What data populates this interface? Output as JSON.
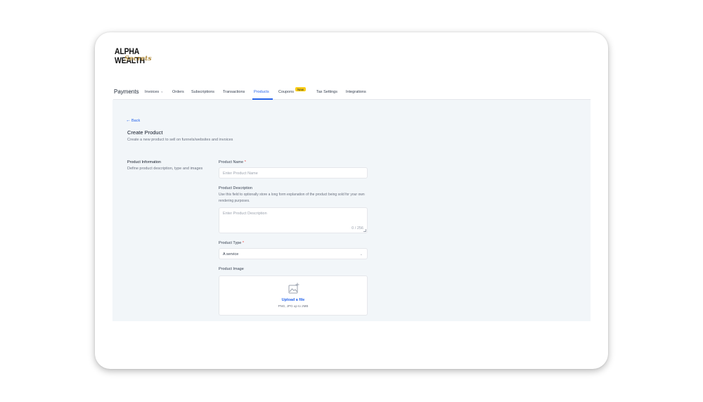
{
  "brand": {
    "name": "ALPHA WEALTH",
    "script": "Secrets"
  },
  "nav": {
    "title": "Payments",
    "items": [
      {
        "label": "Invoices",
        "has_dropdown": true
      },
      {
        "label": "Orders"
      },
      {
        "label": "Subscriptions"
      },
      {
        "label": "Transactions"
      },
      {
        "label": "Products",
        "active": true
      },
      {
        "label": "Coupons",
        "badge": "New"
      },
      {
        "label": "Tax Settings"
      },
      {
        "label": "Integrations"
      }
    ]
  },
  "page": {
    "back_label": "Back",
    "title": "Create Product",
    "subtitle": "Create a new product to sell on funnels/websites and invoices"
  },
  "section": {
    "title": "Product Information",
    "description": "Define product description, type and images"
  },
  "form": {
    "name": {
      "label": "Product Name",
      "required_mark": "*",
      "placeholder": "Enter Product Name"
    },
    "description": {
      "label": "Product Description",
      "help": "Use this field to optionally store a long form explanation of the product being sold for your own rendering purposes.",
      "placeholder": "Enter Product Description",
      "counter": "0 / 256"
    },
    "type": {
      "label": "Product Type",
      "required_mark": "*",
      "value": "A service"
    },
    "image": {
      "label": "Product Image",
      "upload_label": "Upload a file",
      "hint": "PNG, JPG up to 2MB",
      "icon": "image-add-icon"
    }
  },
  "colors": {
    "accent": "#2563eb",
    "badge": "#facc15",
    "content_bg": "#f2f6f9",
    "required": "#ef4444"
  }
}
